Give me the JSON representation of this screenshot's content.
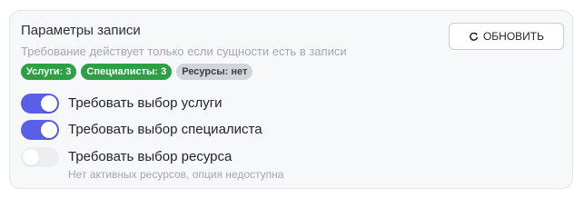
{
  "section": {
    "title": "Параметры записи",
    "subtitle": "Требование действует только если сущности есть в записи"
  },
  "refresh_button": {
    "icon": "refresh-icon",
    "label": "ОБНОВИТЬ"
  },
  "badges": [
    {
      "label": "Услуги: 3",
      "color": "#2e9f44"
    },
    {
      "label": "Специалисты: 3",
      "color": "#2e9f44"
    },
    {
      "label": "Ресурсы: нет",
      "color": "#d2d5da"
    }
  ],
  "toggles": [
    {
      "label": "Требовать выбор услуги",
      "enabled": true,
      "disabled": false
    },
    {
      "label": "Требовать выбор специалиста",
      "enabled": true,
      "disabled": false
    },
    {
      "label": "Требовать выбор ресурса",
      "enabled": false,
      "disabled": true,
      "hint": "Нет активных ресурсов, опция недоступна"
    }
  ],
  "colors": {
    "accent": "#5b5fe6",
    "success": "#2e9f44"
  }
}
